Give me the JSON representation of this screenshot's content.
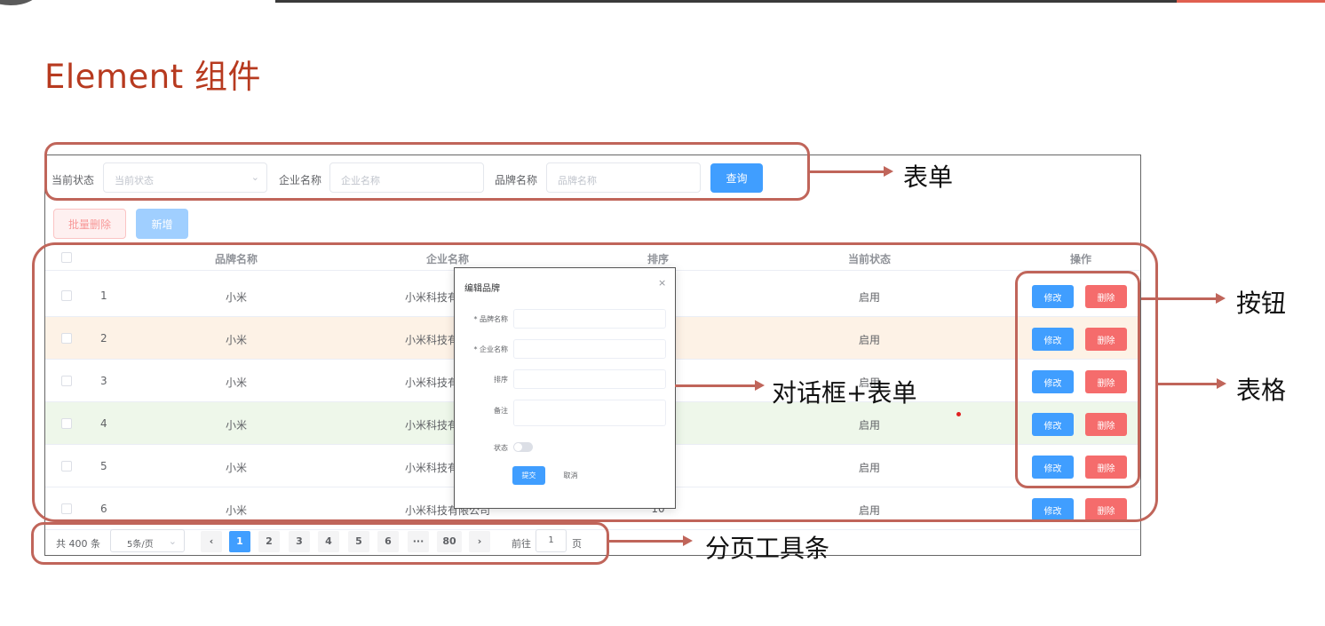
{
  "slide": {
    "title": "Element 组件"
  },
  "search_form": {
    "status_label": "当前状态",
    "status_placeholder": "当前状态",
    "company_label": "企业名称",
    "company_placeholder": "企业名称",
    "brand_label": "品牌名称",
    "brand_placeholder": "品牌名称",
    "query_label": "查询"
  },
  "toolbar": {
    "batch_delete_label": "批量删除",
    "add_label": "新增"
  },
  "table": {
    "columns": [
      "品牌名称",
      "企业名称",
      "排序",
      "当前状态",
      "操作"
    ],
    "rows": [
      {
        "index": "1",
        "brand": "小米",
        "company": "小米科技有",
        "order": "",
        "status": "启用"
      },
      {
        "index": "2",
        "brand": "小米",
        "company": "小米科技有",
        "order": "",
        "status": "启用"
      },
      {
        "index": "3",
        "brand": "小米",
        "company": "小米科技有",
        "order": "",
        "status": "启用"
      },
      {
        "index": "4",
        "brand": "小米",
        "company": "小米科技有",
        "order": "",
        "status": "启用"
      },
      {
        "index": "5",
        "brand": "小米",
        "company": "小米科技有",
        "order": "",
        "status": "启用"
      },
      {
        "index": "6",
        "brand": "小米",
        "company": "小米科技有限公司",
        "order": "10",
        "status": "启用"
      }
    ],
    "edit_label": "修改",
    "delete_label": "删除"
  },
  "pagination": {
    "total": "共 400 条",
    "page_size": "5条/页",
    "prev": "‹",
    "pages": [
      "1",
      "2",
      "3",
      "4",
      "5",
      "6",
      "···",
      "80"
    ],
    "next": "›",
    "goto_label": "前往",
    "goto_value": "1",
    "page_suffix": "页",
    "current_page": 1
  },
  "dialog": {
    "title": "编辑品牌",
    "close": "×",
    "brand_label": "* 品牌名称",
    "company_label": "* 企业名称",
    "order_label": "排序",
    "remark_label": "备注",
    "status_label": "状态",
    "submit_label": "提交",
    "cancel_label": "取消"
  },
  "annotations": {
    "form": "表单",
    "button": "按钮",
    "table": "表格",
    "dialog_form": "对话框+表单",
    "pagination": "分页工具条"
  },
  "colors": {
    "title_red": "#b73a1f",
    "annotation_red": "#c0655a",
    "primary_blue": "#409eff",
    "danger_red": "#f56c6c"
  }
}
